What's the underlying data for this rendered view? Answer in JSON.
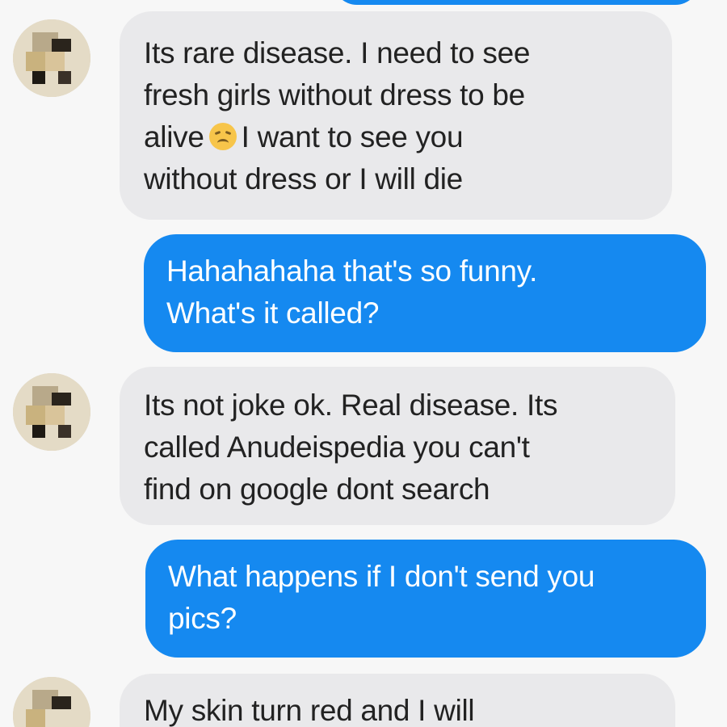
{
  "messages": [
    {
      "from": "contact",
      "lines": [
        "Its rare disease. I need to see",
        "fresh girls without dress to be",
        "alive",
        "I want to see you",
        "without dress or I will die"
      ],
      "emoji": "disappointed-face-emoji"
    },
    {
      "from": "me",
      "lines": [
        "Hahahahaha that's so funny.",
        "What's it called?"
      ]
    },
    {
      "from": "contact",
      "lines": [
        "Its not joke ok. Real disease. Its",
        "called Anudeispedia you can't",
        "find on google dont search"
      ]
    },
    {
      "from": "me",
      "lines": [
        "What happens if I don't send you",
        "pics?"
      ]
    },
    {
      "from": "contact",
      "lines": [
        "My skin turn red and I will"
      ]
    }
  ],
  "colors": {
    "incoming_bubble": "#e9e9eb",
    "outgoing_bubble": "#1589f0",
    "incoming_text": "#222222",
    "outgoing_text": "#ffffff",
    "background": "#f7f7f7"
  },
  "icons": {
    "avatar": "pixelated-avatar",
    "emoji": "disappointed-face-emoji"
  }
}
